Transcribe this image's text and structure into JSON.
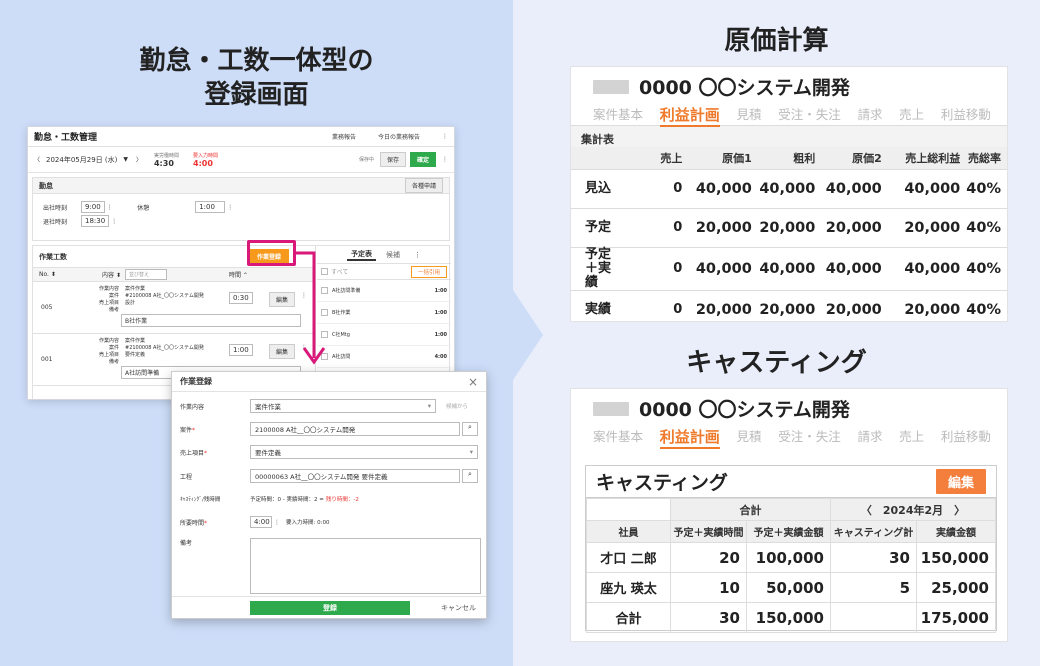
{
  "left": {
    "title_lines": [
      "勤怠・工数一体型の",
      "登録画面"
    ],
    "app": {
      "title": "勤怠・工数管理",
      "nav": [
        "業務報告",
        "今日の業務報告"
      ],
      "date": "2024年05月29日 (水)",
      "actual_label": "実労働時間",
      "actual_value": "4:30",
      "unentered_label": "要入力時間",
      "unentered_value": "4:00",
      "saving": "保存中",
      "save": "保存",
      "confirm": "確定",
      "attendance": {
        "title": "勤怠",
        "apply": "各種申請",
        "in_label": "出社時刻",
        "in_value": "9:00",
        "out_label": "退社時刻",
        "out_value": "18:30",
        "break_label": "休憩",
        "break_value": "1:00"
      },
      "work": {
        "title": "作業工数",
        "register": "作業登録",
        "col_no": "No.",
        "col_content": "内容",
        "col_placeholder": "並び替え",
        "col_time": "時間",
        "rows": [
          {
            "no": "005",
            "labels": "作業内容\n案件\n売上項目\n備考",
            "values": "案件作業\n#2100008 A社_〇〇システム開発\n設計",
            "time": "0:30",
            "note": "B社作業"
          },
          {
            "no": "001",
            "labels": "作業内容\n案件\n売上項目\n備考",
            "values": "案件作業\n#2100008 A社_〇〇システム開発\n要件定義",
            "time": "1:00",
            "note": "A社訪問準備"
          }
        ],
        "edit": "編集",
        "tab_schedule": "予定表",
        "tab_candidate": "候補",
        "all": "すべて",
        "batch": "一括引用",
        "schedule": [
          {
            "name": "A社訪問準備",
            "time": "1:00"
          },
          {
            "name": "B社作業",
            "time": "1:00"
          },
          {
            "name": "C社Mtg",
            "time": "1:00"
          },
          {
            "name": "A社訪問",
            "time": "4:00"
          }
        ]
      }
    },
    "modal": {
      "title": "作業登録",
      "close": "×",
      "content_label": "作業内容",
      "content_value": "案件作業",
      "content_hint": "候補から",
      "project_label": "案件",
      "project_value": "2100008 A社__〇〇システム開発",
      "sales_label": "売上項目",
      "sales_value": "要件定義",
      "process_label": "工程",
      "process_value": "00000063 A社__〇〇システム開発 要件定義",
      "casting_label": "ｷｬｽﾃｨﾝｸﾞ/残時間",
      "casting_value": "予定時間：0 - 実績時間：2 =",
      "casting_remain": "残り時間：-2",
      "required_label": "所要時間",
      "required_value": "4:00",
      "required_hint": "要入力時間: 0:00",
      "note_label": "備考",
      "submit": "登録",
      "cancel": "キャンセル"
    }
  },
  "genka": {
    "title": "原価計算",
    "project": "0000 〇〇システム開発",
    "tabs": [
      "案件基本",
      "利益計画",
      "見積",
      "受注・失注",
      "請求",
      "売上",
      "利益移動"
    ],
    "summary": "集計表",
    "headers": [
      "",
      "",
      "売上",
      "原価1",
      "粗利",
      "原価2",
      "売上総利益",
      "売総率"
    ],
    "rows": [
      {
        "label": "見込",
        "cells": [
          "0",
          "40,000",
          "40,000",
          "40,000",
          "40,000",
          "40%"
        ]
      },
      {
        "label": "予定",
        "cells": [
          "0",
          "20,000",
          "20,000",
          "20,000",
          "20,000",
          "40%"
        ]
      },
      {
        "label": "予定\n＋実績",
        "cells": [
          "0",
          "40,000",
          "40,000",
          "40,000",
          "40,000",
          "40%"
        ]
      },
      {
        "label": "実績",
        "cells": [
          "0",
          "20,000",
          "20,000",
          "20,000",
          "20,000",
          "40%"
        ]
      }
    ]
  },
  "casting": {
    "title": "キャスティング",
    "project": "0000 〇〇システム開発",
    "tabs": [
      "案件基本",
      "利益計画",
      "見積",
      "受注・失注",
      "請求",
      "売上",
      "利益移動"
    ],
    "card_title": "キャスティング",
    "edit": "編集",
    "total_group": "合計",
    "month_nav": "〈　2024年2月　〉",
    "headers": [
      "社員",
      "予定＋実績時間",
      "予定＋実績金額",
      "キャスティング計",
      "実績金額"
    ],
    "rows": [
      {
        "name": "才口 二郎",
        "hours": "20",
        "amount": "100,000",
        "cast": "30",
        "actual": "150,000"
      },
      {
        "name": "座九 瑛太",
        "hours": "10",
        "amount": "50,000",
        "cast": "5",
        "actual": "25,000"
      },
      {
        "name": "合計",
        "hours": "30",
        "amount": "150,000",
        "cast": "",
        "actual": "175,000"
      }
    ]
  }
}
